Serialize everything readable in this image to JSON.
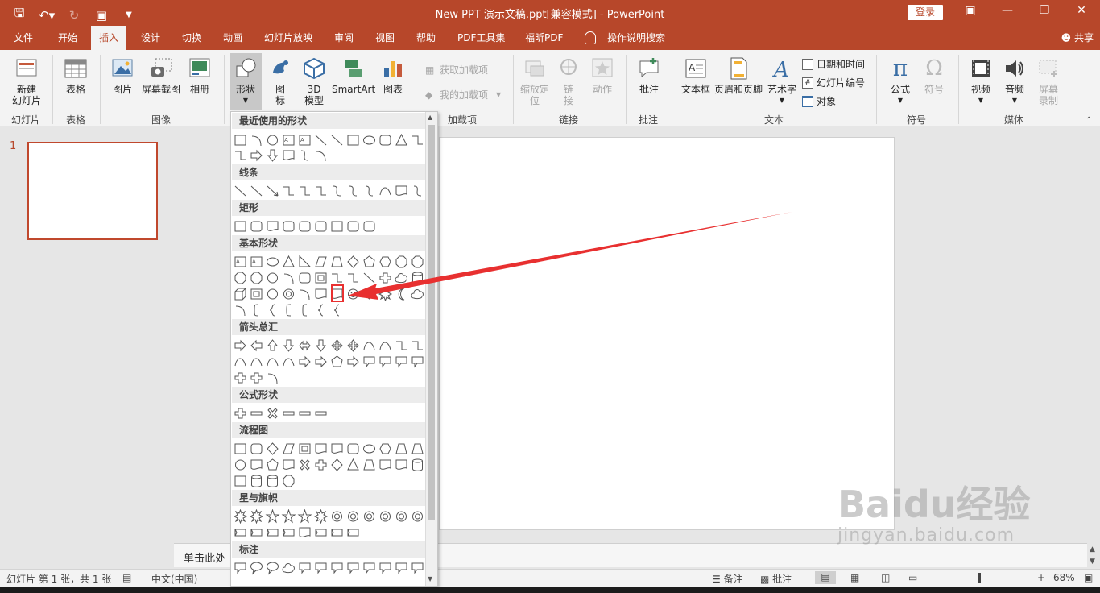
{
  "titlebar": {
    "title": "New PPT 演示文稿.ppt[兼容模式]  -  PowerPoint",
    "login": "登录",
    "colors": {
      "accent": "#b7472a"
    }
  },
  "menu": {
    "tabs": [
      "文件",
      "开始",
      "插入",
      "设计",
      "切换",
      "动画",
      "幻灯片放映",
      "审阅",
      "视图",
      "帮助",
      "PDF工具集",
      "福昕PDF"
    ],
    "active_tab": "插入",
    "search": "操作说明搜索",
    "share": "共享"
  },
  "ribbon": {
    "new_slide": "新建\n幻灯片",
    "group_slides": "幻灯片",
    "table": "表格",
    "group_table": "表格",
    "picture": "图片",
    "screenshot": "屏幕截图",
    "album": "相册",
    "group_images": "图像",
    "shapes": "形状",
    "icons": "图\n标",
    "model3d": "3D\n模型",
    "smartart": "SmartArt",
    "chart": "图表",
    "get_addins": "获取加载项",
    "my_addins": "我的加载项",
    "group_addins": "加载项",
    "zoom": "缩放定\n位",
    "link": "链\n接",
    "action": "动作",
    "group_links": "链接",
    "comment": "批注",
    "group_comments": "批注",
    "textbox": "文本框",
    "header_footer": "页眉和页脚",
    "wordart": "艺术字",
    "datetime": "日期和时间",
    "slide_number": "幻灯片编号",
    "object": "对象",
    "group_text": "文本",
    "equation": "公式",
    "symbol": "符号",
    "group_symbols": "符号",
    "video": "视频",
    "audio": "音频",
    "screen_record": "屏幕\n录制",
    "group_media": "媒体"
  },
  "shapes_menu": {
    "categories": [
      "最近使用的形状",
      "线条",
      "矩形",
      "基本形状",
      "箭头总汇",
      "公式形状",
      "流程图",
      "星与旗帜",
      "标注"
    ]
  },
  "slides_pane": {
    "slide_number": "1"
  },
  "notes": {
    "placeholder": "单击此处"
  },
  "status": {
    "slide_info": "幻灯片 第 1 张，共 1 张",
    "language": "中文(中国)",
    "notes": "备注",
    "comments": "批注",
    "zoom": "68%"
  },
  "watermark": {
    "logo": "Baidu经验",
    "url": "jingyan.baidu.com"
  }
}
